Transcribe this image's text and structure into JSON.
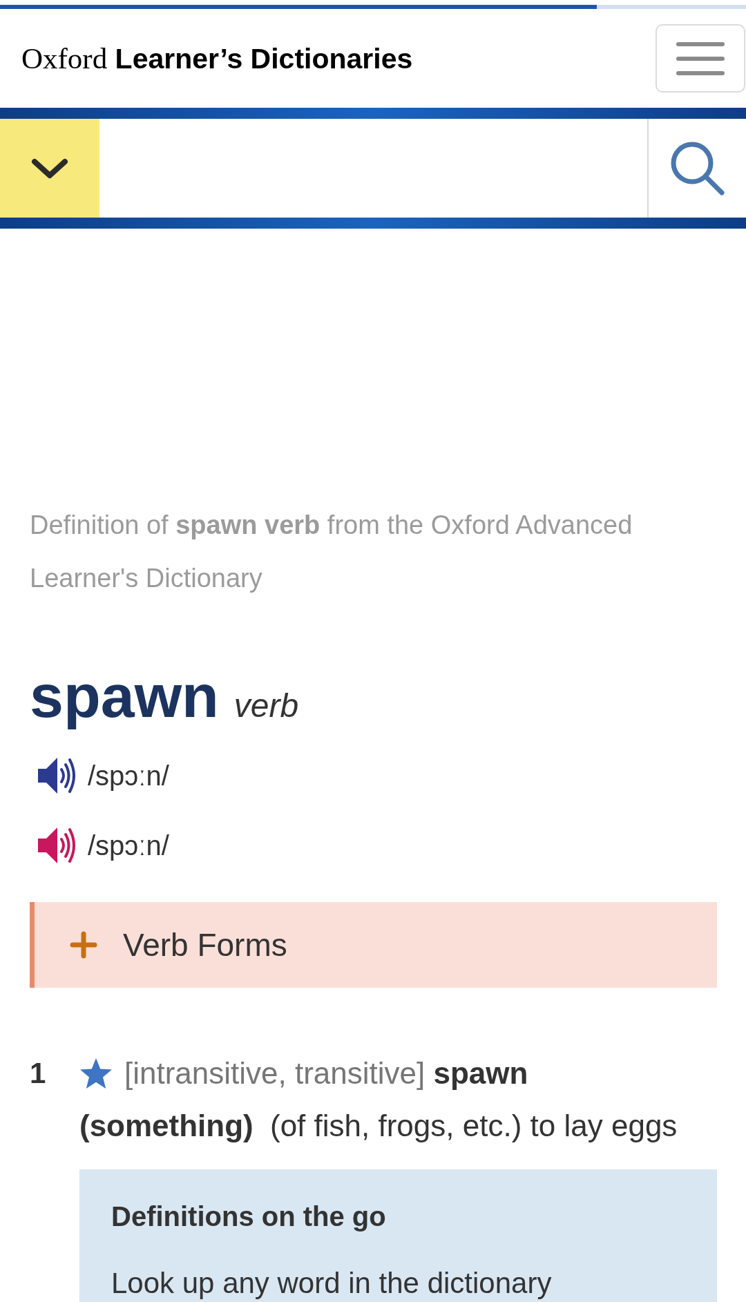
{
  "load_progress": {
    "level": 0.8
  },
  "header": {
    "logo": {
      "brand": "Oxford",
      "name": "Learner’s Dictionaries"
    }
  },
  "source_line": "Definition of **spawn verb** from the Oxford Advanced Learner's Dictionary",
  "entry": {
    "headword": "spawn",
    "part_of_speech": "verb",
    "pronunciations": [
      {
        "text": "/spɔːn/",
        "color": "#2b3990"
      },
      {
        "text": "/spɔːn/",
        "color": "#c8175d"
      }
    ],
    "verb_forms": {
      "label": "Verb Forms",
      "expanded": false
    },
    "senses": [
      {
        "number": "1",
        "starred": true,
        "grammar": "[intransitive, transitive]",
        "pattern": "spawn (something)",
        "definition": "(of fish, frogs, etc.) to lay eggs"
      }
    ]
  },
  "promo": {
    "title": "Definitions on the go",
    "text": "Look up any word in the dictionary"
  }
}
